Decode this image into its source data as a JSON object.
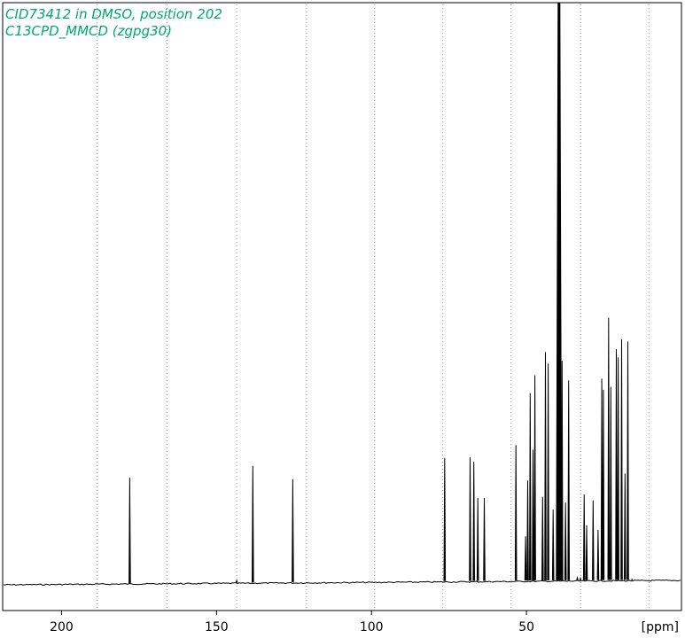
{
  "chart_data": {
    "type": "line",
    "title": "CID73412 in DMSO, position 202",
    "subtitle": "C13CPD_MMCD (zgpg30)",
    "xlabel": "[ppm]",
    "ylabel": "",
    "xlim": [
      219,
      0
    ],
    "ylim": [
      0,
      1.0
    ],
    "x_ticks": [
      200,
      150,
      100,
      50
    ],
    "x_tick_labels": [
      "200",
      "150",
      "100",
      "50"
    ],
    "dotted_grid_ppm": [
      188.5,
      166,
      143.5,
      121,
      99,
      77,
      55,
      32.5,
      10.5
    ],
    "baseline": 0.0,
    "title_color": "#00a86b",
    "line_color": "#000000",
    "peaks": [
      {
        "ppm": 178.0,
        "height": 0.183
      },
      {
        "ppm": 143.5,
        "height": 0.006
      },
      {
        "ppm": 138.3,
        "height": 0.203
      },
      {
        "ppm": 125.4,
        "height": 0.18
      },
      {
        "ppm": 76.4,
        "height": 0.217
      },
      {
        "ppm": 68.2,
        "height": 0.218
      },
      {
        "ppm": 67.0,
        "height": 0.21
      },
      {
        "ppm": 65.7,
        "height": 0.148
      },
      {
        "ppm": 63.6,
        "height": 0.148
      },
      {
        "ppm": 53.4,
        "height": 0.239
      },
      {
        "ppm": 50.3,
        "height": 0.082
      },
      {
        "ppm": 49.6,
        "height": 0.178
      },
      {
        "ppm": 48.8,
        "height": 0.328
      },
      {
        "ppm": 47.9,
        "height": 0.231
      },
      {
        "ppm": 47.3,
        "height": 0.359
      },
      {
        "ppm": 44.8,
        "height": 0.15
      },
      {
        "ppm": 43.9,
        "height": 0.399
      },
      {
        "ppm": 43.0,
        "height": 0.379
      },
      {
        "ppm": 41.4,
        "height": 0.128
      },
      {
        "ppm": 39.5,
        "height": 1.0
      },
      {
        "ppm": 38.5,
        "height": 0.384
      },
      {
        "ppm": 37.4,
        "height": 0.14
      },
      {
        "ppm": 36.4,
        "height": 0.35
      },
      {
        "ppm": 33.6,
        "height": 0.011
      },
      {
        "ppm": 32.6,
        "height": 0.01
      },
      {
        "ppm": 31.4,
        "height": 0.154
      },
      {
        "ppm": 30.6,
        "height": 0.101
      },
      {
        "ppm": 28.5,
        "height": 0.144
      },
      {
        "ppm": 26.9,
        "height": 0.093
      },
      {
        "ppm": 25.7,
        "height": 0.353
      },
      {
        "ppm": 25.2,
        "height": 0.334
      },
      {
        "ppm": 23.5,
        "height": 0.458
      },
      {
        "ppm": 22.8,
        "height": 0.339
      },
      {
        "ppm": 21.0,
        "height": 0.404
      },
      {
        "ppm": 20.4,
        "height": 0.39
      },
      {
        "ppm": 19.3,
        "height": 0.421
      },
      {
        "ppm": 18.2,
        "height": 0.19
      },
      {
        "ppm": 17.3,
        "height": 0.417
      },
      {
        "ppm": 16.0,
        "height": 0.008
      }
    ]
  }
}
